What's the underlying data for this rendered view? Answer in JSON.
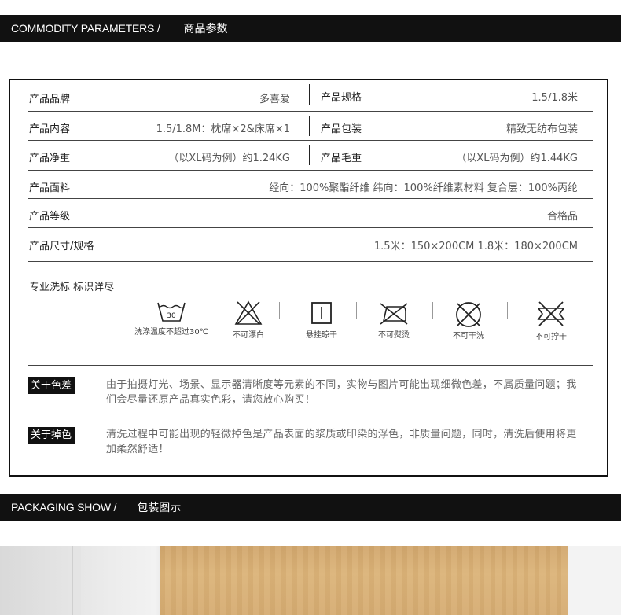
{
  "header": {
    "en": "COMMODITY PARAMETERS /",
    "cn": "商品参数"
  },
  "params": {
    "brand_label": "产品品牌",
    "brand_value": "多喜爱",
    "spec_label": "产品规格",
    "spec_value": "1.5/1.8米",
    "content_label": "产品内容",
    "content_value": "1.5/1.8M：枕席×2&床席×1",
    "pack_label": "产品包装",
    "pack_value": "精致无纺布包装",
    "net_label": "产品净重",
    "net_value": "（以XL码为例）约1.24KG",
    "gross_label": "产品毛重",
    "gross_value": "（以XL码为例）约1.44KG",
    "fabric_label": "产品面料",
    "fabric_value": "经向：100%聚酯纤维 纬向：100%纤维素材料 复合层：100%丙纶",
    "grade_label": "产品等级",
    "grade_value": "合格品",
    "size_label": "产品尺寸/规格",
    "size_value": "1.5米：150×200CM  1.8米：180×200CM"
  },
  "wash": {
    "title": "专业洗标 标识详尽",
    "items": [
      {
        "icon": "wash-30-icon",
        "number": "30",
        "caption": "洗涤温度不超过30℃"
      },
      {
        "icon": "no-bleach-icon",
        "caption": "不可漂白"
      },
      {
        "icon": "hang-dry-icon",
        "caption": "悬挂晾干"
      },
      {
        "icon": "no-iron-icon",
        "caption": "不可熨烫"
      },
      {
        "icon": "no-dry-clean-icon",
        "caption": "不可干洗"
      },
      {
        "icon": "no-wring-icon",
        "caption": "不可拧干"
      }
    ]
  },
  "notes": {
    "color_tag": "关于色差",
    "color_text": "由于拍摄灯光、场景、显示器清晰度等元素的不同，实物与图片可能出现细微色差，不属质量问题；我们会尽量还原产品真实色彩，请您放心购买！",
    "fade_tag": "关于掉色",
    "fade_text": "清洗过程中可能出现的轻微掉色是产品表面的浆质或印染的浮色，非质量问题，同时，清洗后使用将更加柔然舒适！"
  },
  "packaging": {
    "en": "PACKAGING SHOW /",
    "cn": "包装图示"
  }
}
